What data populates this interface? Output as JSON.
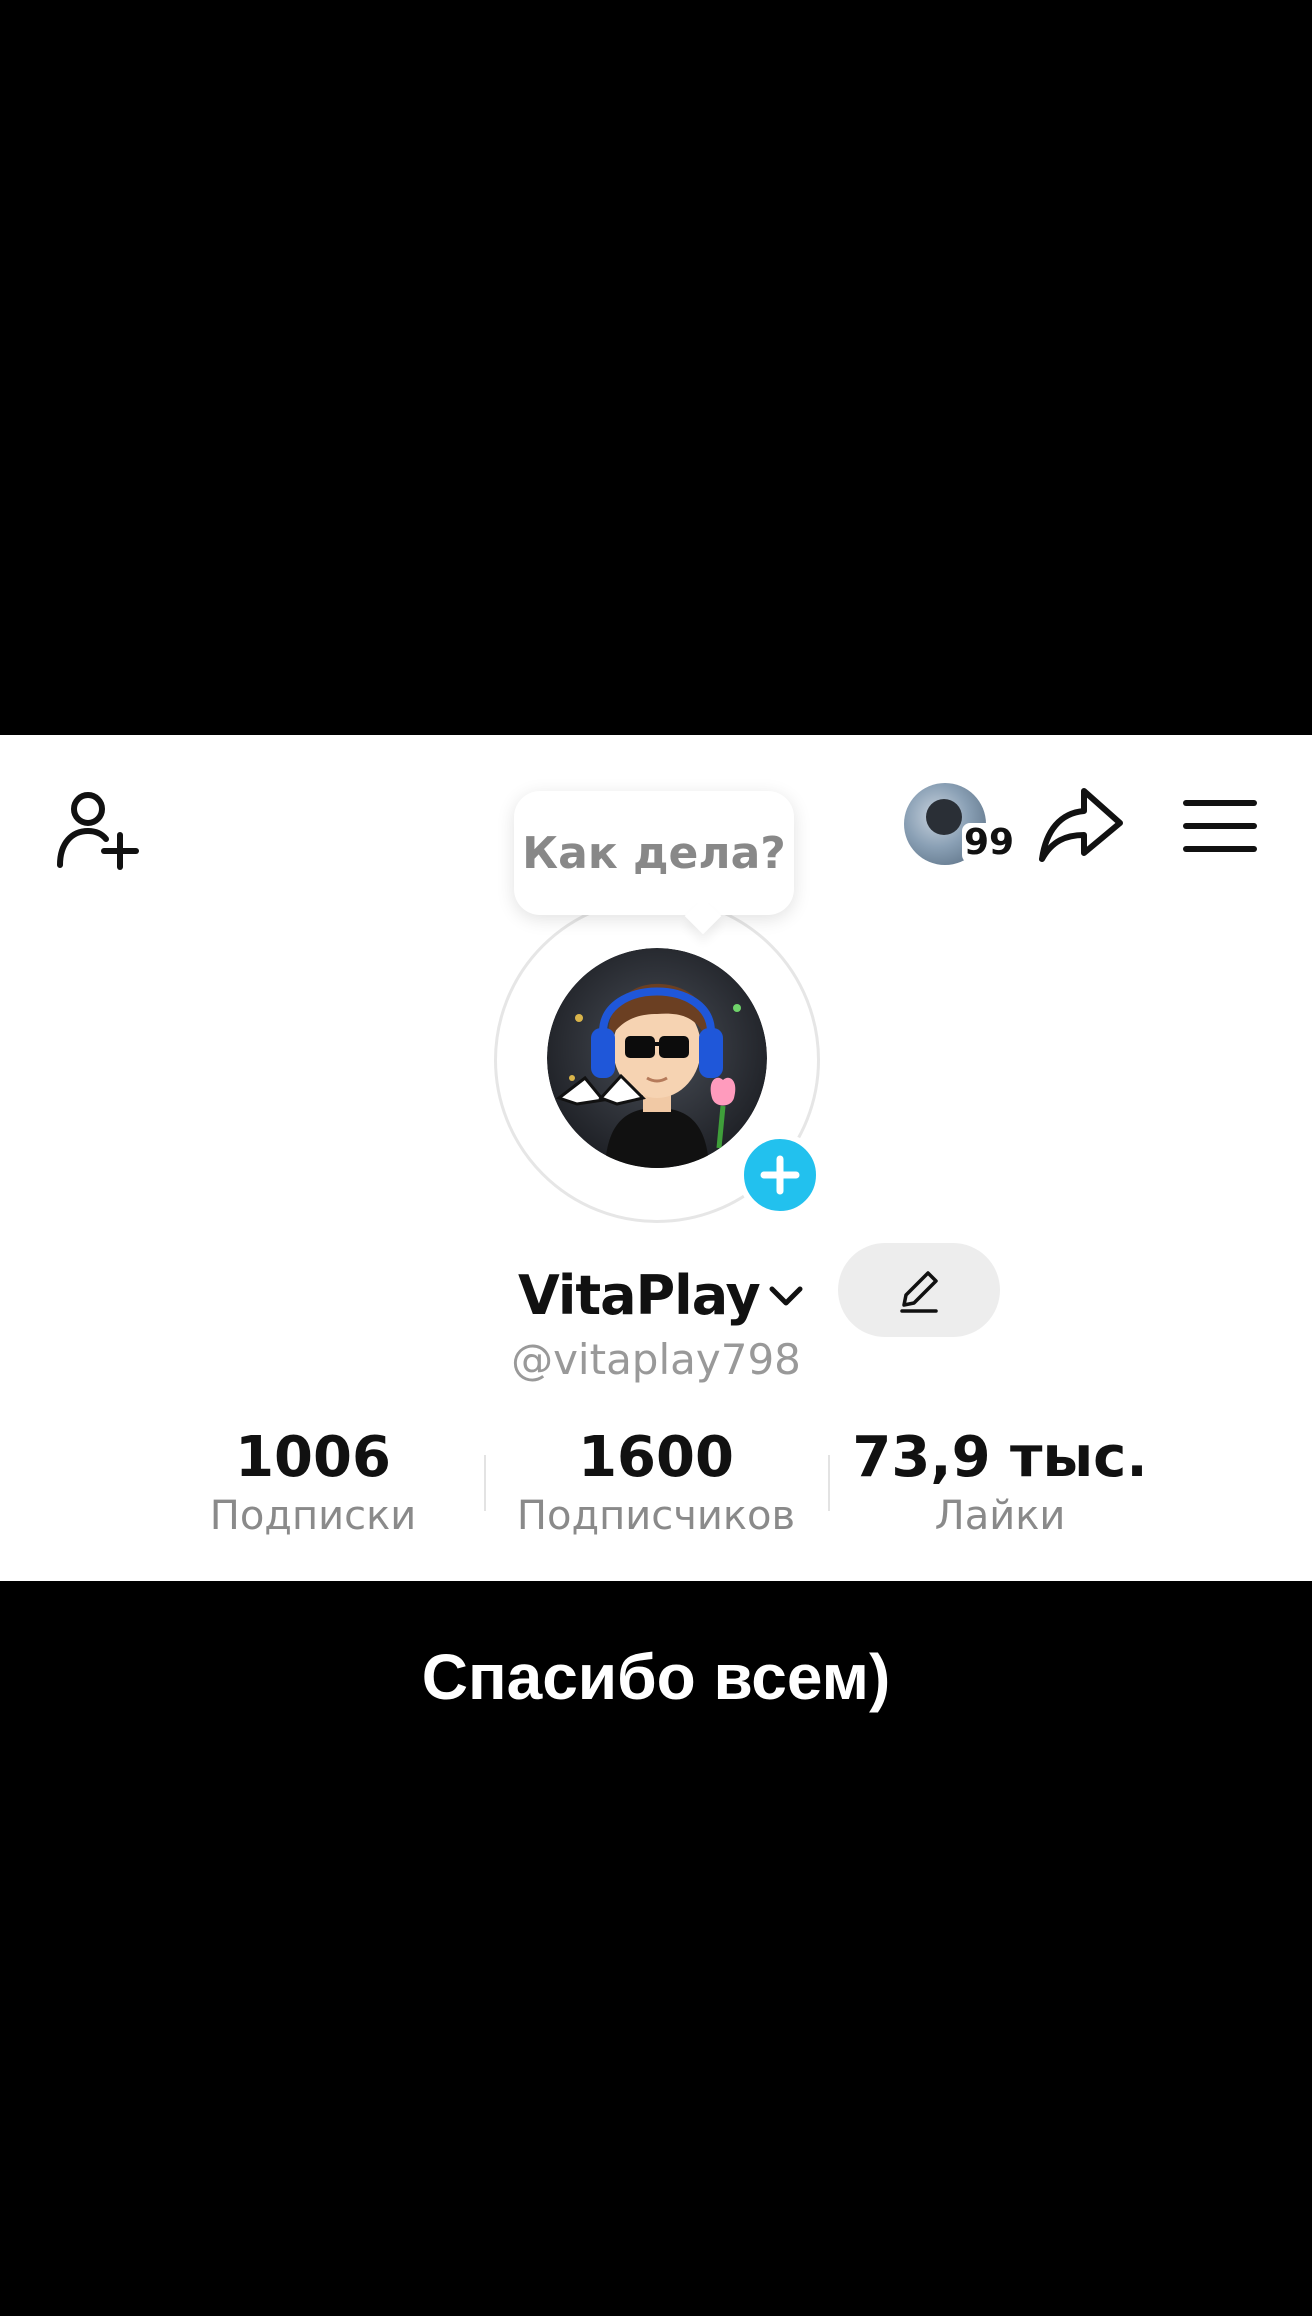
{
  "header": {
    "add_friend_icon": "person-add-icon",
    "profile_visitors_count": "99",
    "share_icon": "share-arrow-icon",
    "menu_icon": "hamburger-menu-icon"
  },
  "profile": {
    "note_bubble": "Как дела?",
    "display_name": "VitaPlay",
    "handle": "@vitaplay798",
    "add_story_icon": "plus-icon",
    "edit_icon": "pencil-icon"
  },
  "stats": [
    {
      "value": "1006",
      "label": "Подписки"
    },
    {
      "value": "1600",
      "label": "Подписчиков"
    },
    {
      "value": "73,9 тыс.",
      "label": "Лайки"
    }
  ],
  "caption": "Спасибо всем)",
  "colors": {
    "accent": "#22c1ee",
    "background": "#000000",
    "panel": "#ffffff"
  }
}
